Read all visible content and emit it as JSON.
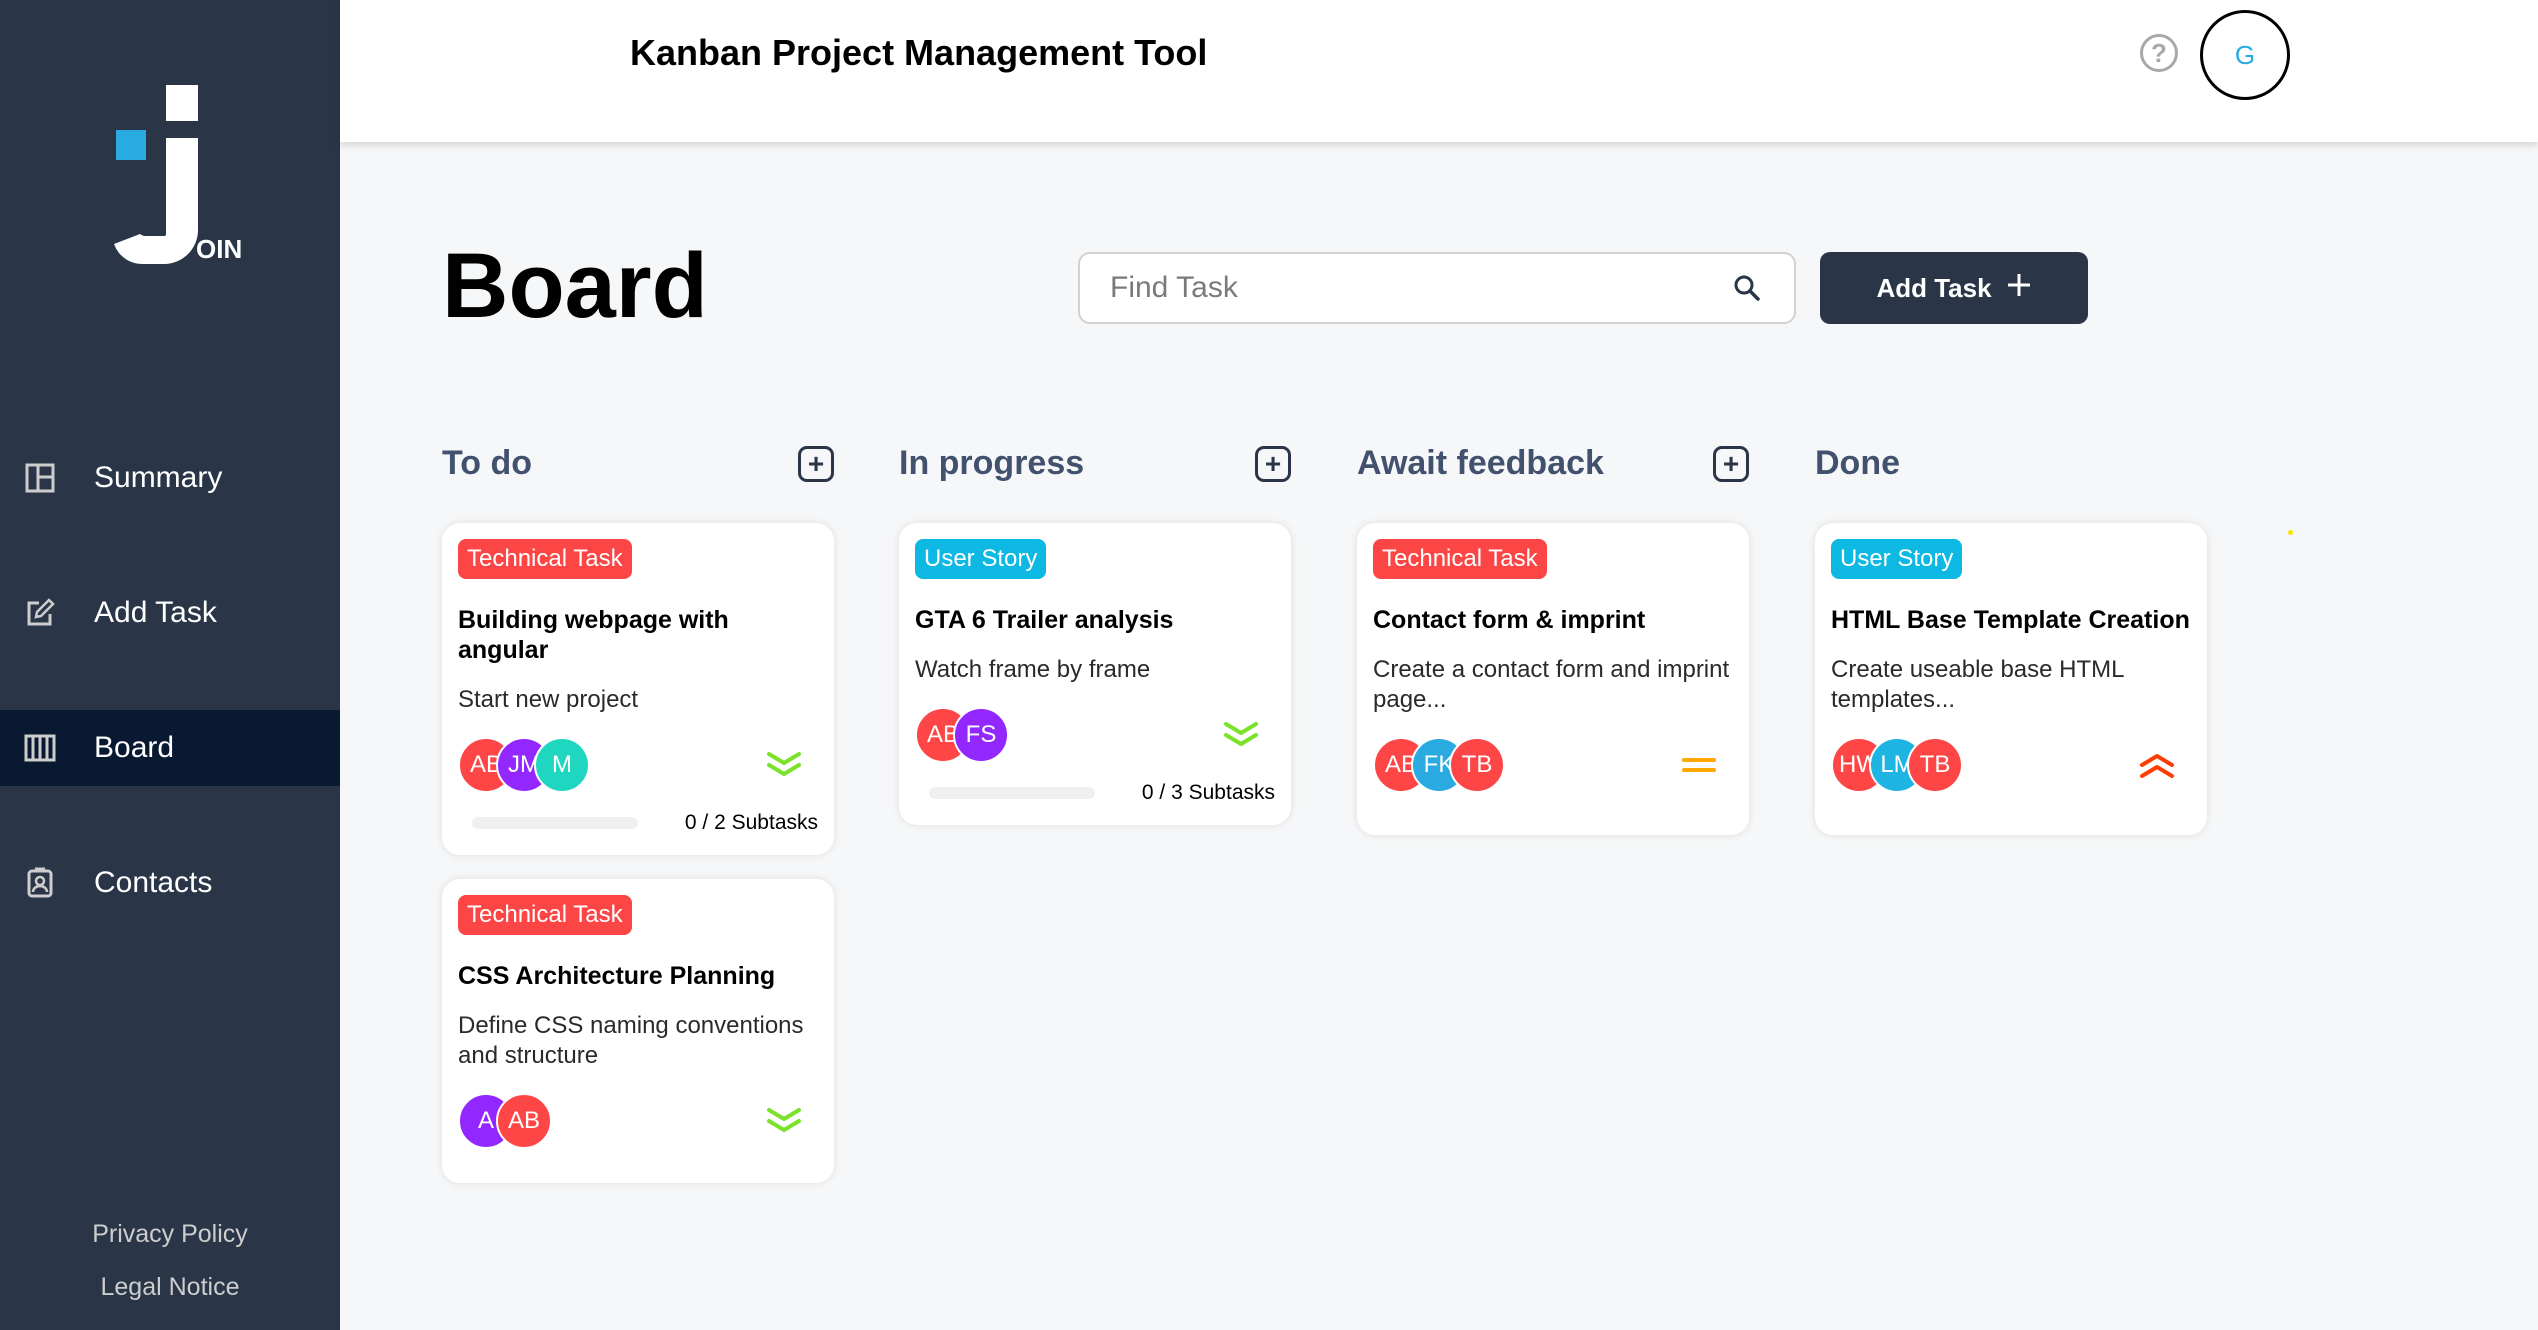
{
  "header": {
    "title": "Kanban Project Management Tool",
    "help_icon": "question-circle-icon",
    "user_initial": "G"
  },
  "sidebar": {
    "logo_text": "OIN",
    "items": [
      {
        "label": "Summary",
        "icon": "summary-icon"
      },
      {
        "label": "Add Task",
        "icon": "edit-icon"
      },
      {
        "label": "Board",
        "icon": "board-icon",
        "active": true
      },
      {
        "label": "Contacts",
        "icon": "contacts-icon"
      }
    ],
    "privacy": "Privacy Policy",
    "legal": "Legal Notice"
  },
  "board": {
    "title": "Board",
    "search_placeholder": "Find Task",
    "add_task_label": "Add Task"
  },
  "colors": {
    "technical": "#fc4545",
    "story": "#0db8e3",
    "sidebar": "#2a3647",
    "active": "#091931"
  },
  "columns": [
    {
      "title": "To do",
      "cards": [
        {
          "tag": "Technical Task",
          "title": "Building webpage with angular",
          "desc": "Start new project",
          "avatars": [
            {
              "initials": "AB",
              "color": "#ff4646"
            },
            {
              "initials": "JM",
              "color": "#9327ff"
            },
            {
              "initials": "M",
              "color": "#1fd7c1"
            }
          ],
          "priority": "low",
          "subtasks": "0 / 2 Subtasks",
          "progress": 0
        },
        {
          "tag": "Technical Task",
          "title": "CSS Architecture Planning",
          "desc": "Define CSS naming conventions and structure",
          "avatars": [
            {
              "initials": "A",
              "color": "#9327ff"
            },
            {
              "initials": "AB",
              "color": "#ff4646"
            }
          ],
          "priority": "low"
        }
      ]
    },
    {
      "title": "In progress",
      "cards": [
        {
          "tag": "User Story",
          "title": "GTA 6 Trailer analysis",
          "desc": "Watch frame by frame",
          "avatars": [
            {
              "initials": "AB",
              "color": "#ff4646"
            },
            {
              "initials": "FS",
              "color": "#9327ff"
            }
          ],
          "priority": "low",
          "subtasks": "0 / 3 Subtasks",
          "progress": 0
        }
      ]
    },
    {
      "title": "Await feedback",
      "cards": [
        {
          "tag": "Technical Task",
          "title": "Contact form & imprint",
          "desc": "Create a contact form and imprint page...",
          "avatars": [
            {
              "initials": "AB",
              "color": "#ff4646"
            },
            {
              "initials": "FK",
              "color": "#29abe2"
            },
            {
              "initials": "TB",
              "color": "#ff4646"
            }
          ],
          "priority": "medium"
        }
      ]
    },
    {
      "title": "Done",
      "cards": [
        {
          "tag": "User Story",
          "title": "HTML Base Template Creation",
          "desc": "Create useable base HTML templates...",
          "avatars": [
            {
              "initials": "HW",
              "color": "#ff4646"
            },
            {
              "initials": "LM",
              "color": "#1fb5e3"
            },
            {
              "initials": "TB",
              "color": "#ff4646"
            }
          ],
          "priority": "urgent"
        }
      ]
    }
  ]
}
